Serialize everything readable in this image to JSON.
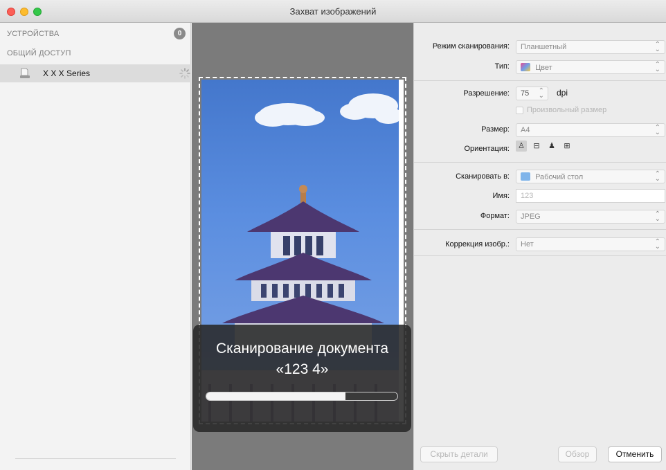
{
  "window": {
    "title": "Захват изображений"
  },
  "sidebar": {
    "devices_header": "УСТРОЙСТВА",
    "devices_count": "0",
    "shared_header": "ОБЩИЙ ДОСТУП",
    "device": {
      "name": "X X X  Series",
      "icon": "printer-icon"
    }
  },
  "overlay": {
    "title": "Сканирование документа",
    "subtitle": "«123 4»",
    "progress": 0.73
  },
  "settings": {
    "scan_mode": {
      "label": "Режим сканирования:",
      "value": "Планшетный"
    },
    "type": {
      "label": "Тип:",
      "value": "Цвет",
      "icon": "color-swatch-icon"
    },
    "resolution": {
      "label": "Разрешение:",
      "value": "75",
      "unit": "dpi"
    },
    "custom_size": {
      "label": "Произвольный размер",
      "checked": false
    },
    "size": {
      "label": "Размер:",
      "value": "A4"
    },
    "orientation": {
      "label": "Ориентация:"
    },
    "scan_to": {
      "label": "Сканировать в:",
      "value": "Рабочий стол",
      "icon": "folder-icon"
    },
    "name": {
      "label": "Имя:",
      "value": "123"
    },
    "format": {
      "label": "Формат:",
      "value": "JPEG"
    },
    "correction": {
      "label": "Коррекция изобр.:",
      "value": "Нет"
    }
  },
  "buttons": {
    "hide_details": "Скрыть детали",
    "overview": "Обзор",
    "cancel": "Отменить"
  },
  "colors": {
    "close": "#fc5f57",
    "minimize": "#fdbc2e",
    "maximize": "#34c84a",
    "sky": "#4477cc"
  }
}
